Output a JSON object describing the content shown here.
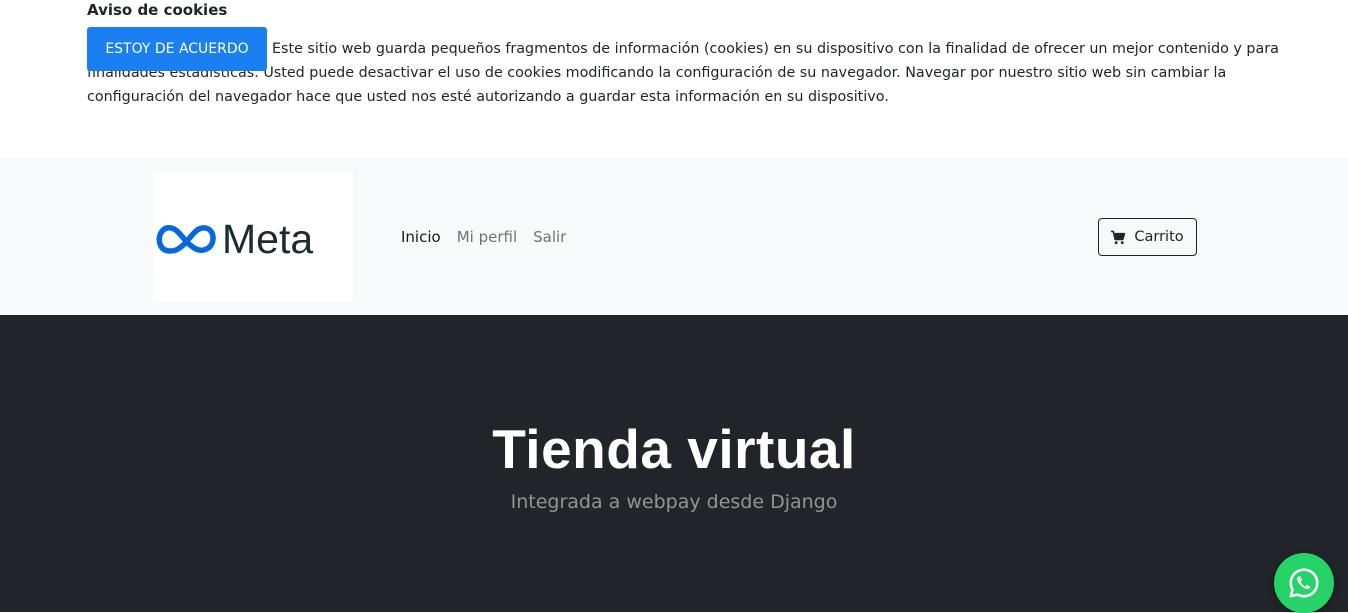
{
  "cookie_notice": {
    "title": "Aviso de cookies",
    "accept_label": "ESTOY DE ACUERDO",
    "text": "Este sitio web guarda pequeños fragmentos de información (cookies) en su dispositivo con la finalidad de ofrecer un mejor contenido y para finalidades estadísticas. Usted puede desactivar el uso de cookies modificando la configuración de su navegador. Navegar por nuestro sitio web sin cambiar la configuración del navegador hace que usted nos esté autorizando a guardar esta información en su dispositivo.",
    "accent_color": "#1a7ff0"
  },
  "navbar": {
    "logo_text": "Meta",
    "links": [
      {
        "label": "Inicio",
        "active": true
      },
      {
        "label": "Mi perfil",
        "active": false
      },
      {
        "label": "Salir",
        "active": false
      }
    ],
    "cart_label": "Carrito",
    "cart_icon": "shopping-cart-icon"
  },
  "hero": {
    "title": "Tienda virtual",
    "subtitle": "Integrada a webpay desde Django",
    "background": "#212529"
  },
  "whatsapp": {
    "icon": "whatsapp-icon",
    "color": "#25d366"
  }
}
